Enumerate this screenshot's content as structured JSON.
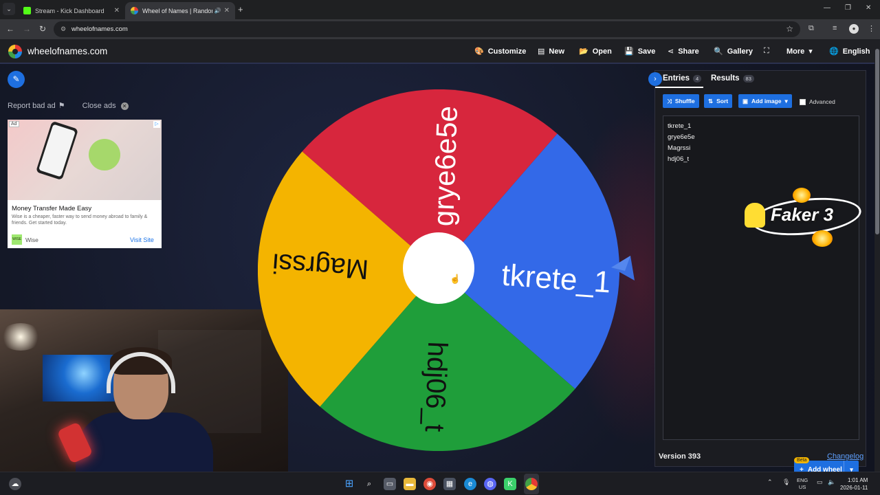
{
  "browser": {
    "tabs": [
      {
        "title": "Stream - Kick Dashboard",
        "active": false,
        "favicon_color": "#53fc18"
      },
      {
        "title": "Wheel of Names | Random",
        "active": true,
        "favicon_color": "#e53935"
      }
    ],
    "url": "wheelofnames.com"
  },
  "app": {
    "brand": "wheelofnames.com",
    "menu": [
      "Customize",
      "New",
      "Open",
      "Save",
      "Share",
      "Gallery",
      "More",
      "English"
    ]
  },
  "left": {
    "report_bad_ad": "Report bad ad",
    "close_ads": "Close ads",
    "ad": {
      "badge": "Ad",
      "title": "Money Transfer Made Easy",
      "description": "Wise is a cheaper, faster way to send money abroad to family & friends. Get started today.",
      "logo_text": "WISE",
      "advertiser": "Wise",
      "cta": "Visit Site"
    }
  },
  "wheel": {
    "slices": [
      {
        "label": "grye6e5e",
        "color": "#d7263d"
      },
      {
        "label": "tkrete_1",
        "color": "#3369e8"
      },
      {
        "label": "hdj06_t",
        "color": "#1f9e3a"
      },
      {
        "label": "Magrssi",
        "color": "#f4b400"
      }
    ]
  },
  "panel": {
    "tabs": [
      {
        "label": "Entries",
        "count": "4"
      },
      {
        "label": "Results",
        "count": "83"
      }
    ],
    "buttons": {
      "shuffle": "Shuffle",
      "sort": "Sort",
      "add_image": "Add image"
    },
    "advanced_label": "Advanced",
    "entries": [
      "tkrete_1",
      "grye6e5e",
      "Magrssi",
      "hdj06_t"
    ],
    "overlay_text": "Faker 3",
    "beta": "Beta",
    "add_wheel": "Add wheel",
    "version": "Version 393",
    "changelog": "Changelog"
  },
  "taskbar": {
    "lang": "ENG",
    "region": "US",
    "time": "1:01 AM",
    "date": "2026-01-11"
  }
}
